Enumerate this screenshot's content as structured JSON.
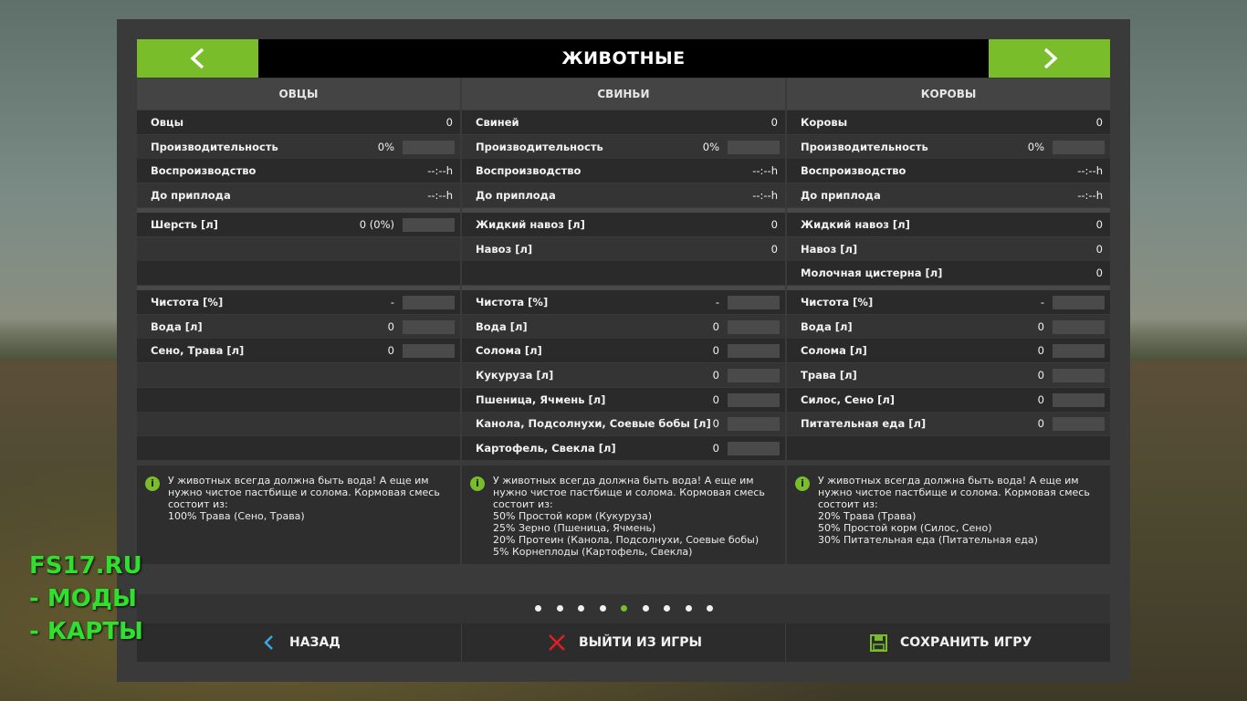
{
  "header": {
    "title": "ЖИВОТНЫЕ"
  },
  "columns": [
    {
      "title": "ОВЦЫ",
      "stats": [
        {
          "label": "Овцы",
          "value": "0"
        },
        {
          "label": "Производительность",
          "value": "0%"
        },
        {
          "label": "Воспроизводство",
          "value": "--:--h"
        },
        {
          "label": "До приплода",
          "value": "--:--h"
        }
      ],
      "products": [
        {
          "label": "Шерсть [л]",
          "value": "0 (0%)"
        }
      ],
      "needs": [
        {
          "label": "Чистота [%]",
          "value": "-"
        },
        {
          "label": "Вода [л]",
          "value": "0"
        },
        {
          "label": "Сено, Трава [л]",
          "value": "0"
        }
      ],
      "info": "У животных всегда должна быть вода! А еще им нужно чистое пастбище и солома. Кормовая смесь состоит из:\n100% Трава (Сено, Трава)"
    },
    {
      "title": "СВИНЬИ",
      "stats": [
        {
          "label": "Свиней",
          "value": "0"
        },
        {
          "label": "Производительность",
          "value": "0%"
        },
        {
          "label": "Воспроизводство",
          "value": "--:--h"
        },
        {
          "label": "До приплода",
          "value": "--:--h"
        }
      ],
      "products": [
        {
          "label": "Жидкий навоз [л]",
          "value": "0"
        },
        {
          "label": "Навоз [л]",
          "value": "0"
        }
      ],
      "needs": [
        {
          "label": "Чистота [%]",
          "value": "-"
        },
        {
          "label": "Вода [л]",
          "value": "0"
        },
        {
          "label": "Солома [л]",
          "value": "0"
        },
        {
          "label": "Кукуруза [л]",
          "value": "0"
        },
        {
          "label": "Пшеница, Ячмень [л]",
          "value": "0"
        },
        {
          "label": "Канола, Подсолнухи, Соевые бобы [л]",
          "value": "0"
        },
        {
          "label": "Картофель, Свекла [л]",
          "value": "0"
        }
      ],
      "info": "У животных всегда должна быть вода! А еще им нужно чистое пастбище и солома. Кормовая смесь состоит из:\n50% Простой корм (Кукуруза)\n25% Зерно (Пшеница, Ячмень)\n20% Протеин (Канола, Подсолнухи, Соевые бобы)\n5% Корнеплоды (Картофель, Свекла)"
    },
    {
      "title": "КОРОВЫ",
      "stats": [
        {
          "label": "Коровы",
          "value": "0"
        },
        {
          "label": "Производительность",
          "value": "0%"
        },
        {
          "label": "Воспроизводство",
          "value": "--:--h"
        },
        {
          "label": "До приплода",
          "value": "--:--h"
        }
      ],
      "products": [
        {
          "label": "Жидкий навоз [л]",
          "value": "0"
        },
        {
          "label": "Навоз [л]",
          "value": "0"
        },
        {
          "label": "Молочная цистерна [л]",
          "value": "0"
        }
      ],
      "needs": [
        {
          "label": "Чистота [%]",
          "value": "-"
        },
        {
          "label": "Вода [л]",
          "value": "0"
        },
        {
          "label": "Солома [л]",
          "value": "0"
        },
        {
          "label": "Трава [л]",
          "value": "0"
        },
        {
          "label": "Силос, Сено [л]",
          "value": "0"
        },
        {
          "label": "Питательная еда [л]",
          "value": "0"
        }
      ],
      "info": "У животных всегда должна быть вода! А еще им нужно чистое пастбище и солома. Кормовая смесь состоит из:\n20% Трава (Трава)\n50% Простой корм (Силос, Сено)\n30% Питательная еда (Питательная еда)"
    }
  ],
  "pagination": {
    "total": 9,
    "active_index": 4
  },
  "footer": {
    "back_label": "НАЗАД",
    "quit_label": "ВЫЙТИ ИЗ ИГРЫ",
    "save_label": "СОХРАНИТЬ ИГРУ"
  },
  "watermark": [
    "FS17.RU",
    "- МОДЫ",
    "- КАРТЫ"
  ],
  "colors": {
    "accent": "#7abd2a",
    "quit_icon": "#e02020",
    "back_icon": "#3fa7e0",
    "watermark": "#2fe02f"
  }
}
